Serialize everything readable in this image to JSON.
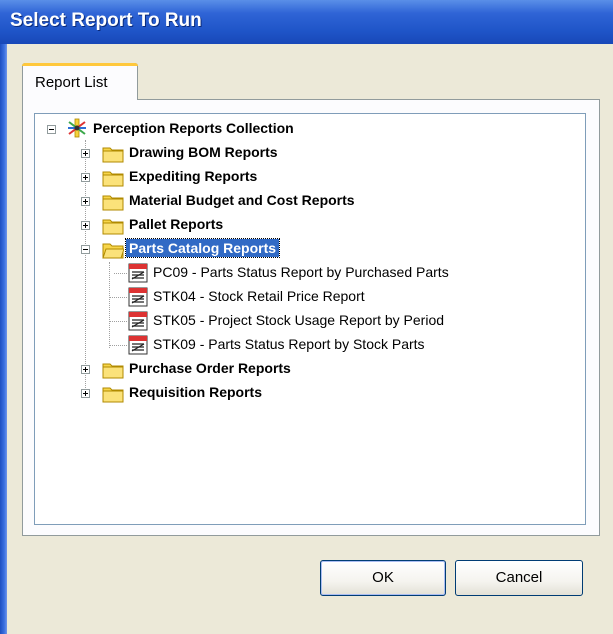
{
  "window": {
    "title": "Select Report To Run"
  },
  "tabs": [
    {
      "label": "Report List"
    }
  ],
  "tree": {
    "root": {
      "label": "Perception Reports Collection"
    },
    "folders": [
      {
        "label": "Drawing BOM Reports",
        "expanded": false
      },
      {
        "label": "Expediting Reports",
        "expanded": false
      },
      {
        "label": "Material Budget and Cost Reports",
        "expanded": false
      },
      {
        "label": "Pallet Reports",
        "expanded": false
      },
      {
        "label": "Parts Catalog Reports",
        "expanded": true,
        "selected": true,
        "reports": [
          {
            "label": "PC09 - Parts Status Report by Purchased Parts"
          },
          {
            "label": "STK04 - Stock Retail Price Report"
          },
          {
            "label": "STK05 - Project Stock Usage Report by Period"
          },
          {
            "label": "STK09 - Parts Status Report by Stock Parts"
          }
        ]
      },
      {
        "label": "Purchase Order Reports",
        "expanded": false
      },
      {
        "label": "Requisition Reports",
        "expanded": false
      }
    ]
  },
  "buttons": {
    "ok": "OK",
    "cancel": "Cancel"
  },
  "colors": {
    "titlebar": "#2f64d6",
    "selection": "#316ac5",
    "folder": "#f7d54a",
    "tab_highlight": "#ffc83c"
  },
  "icons": {
    "root": "report-collection-icon",
    "folder": "folder-icon",
    "open_folder": "folder-open-icon",
    "report": "report-file-icon"
  }
}
